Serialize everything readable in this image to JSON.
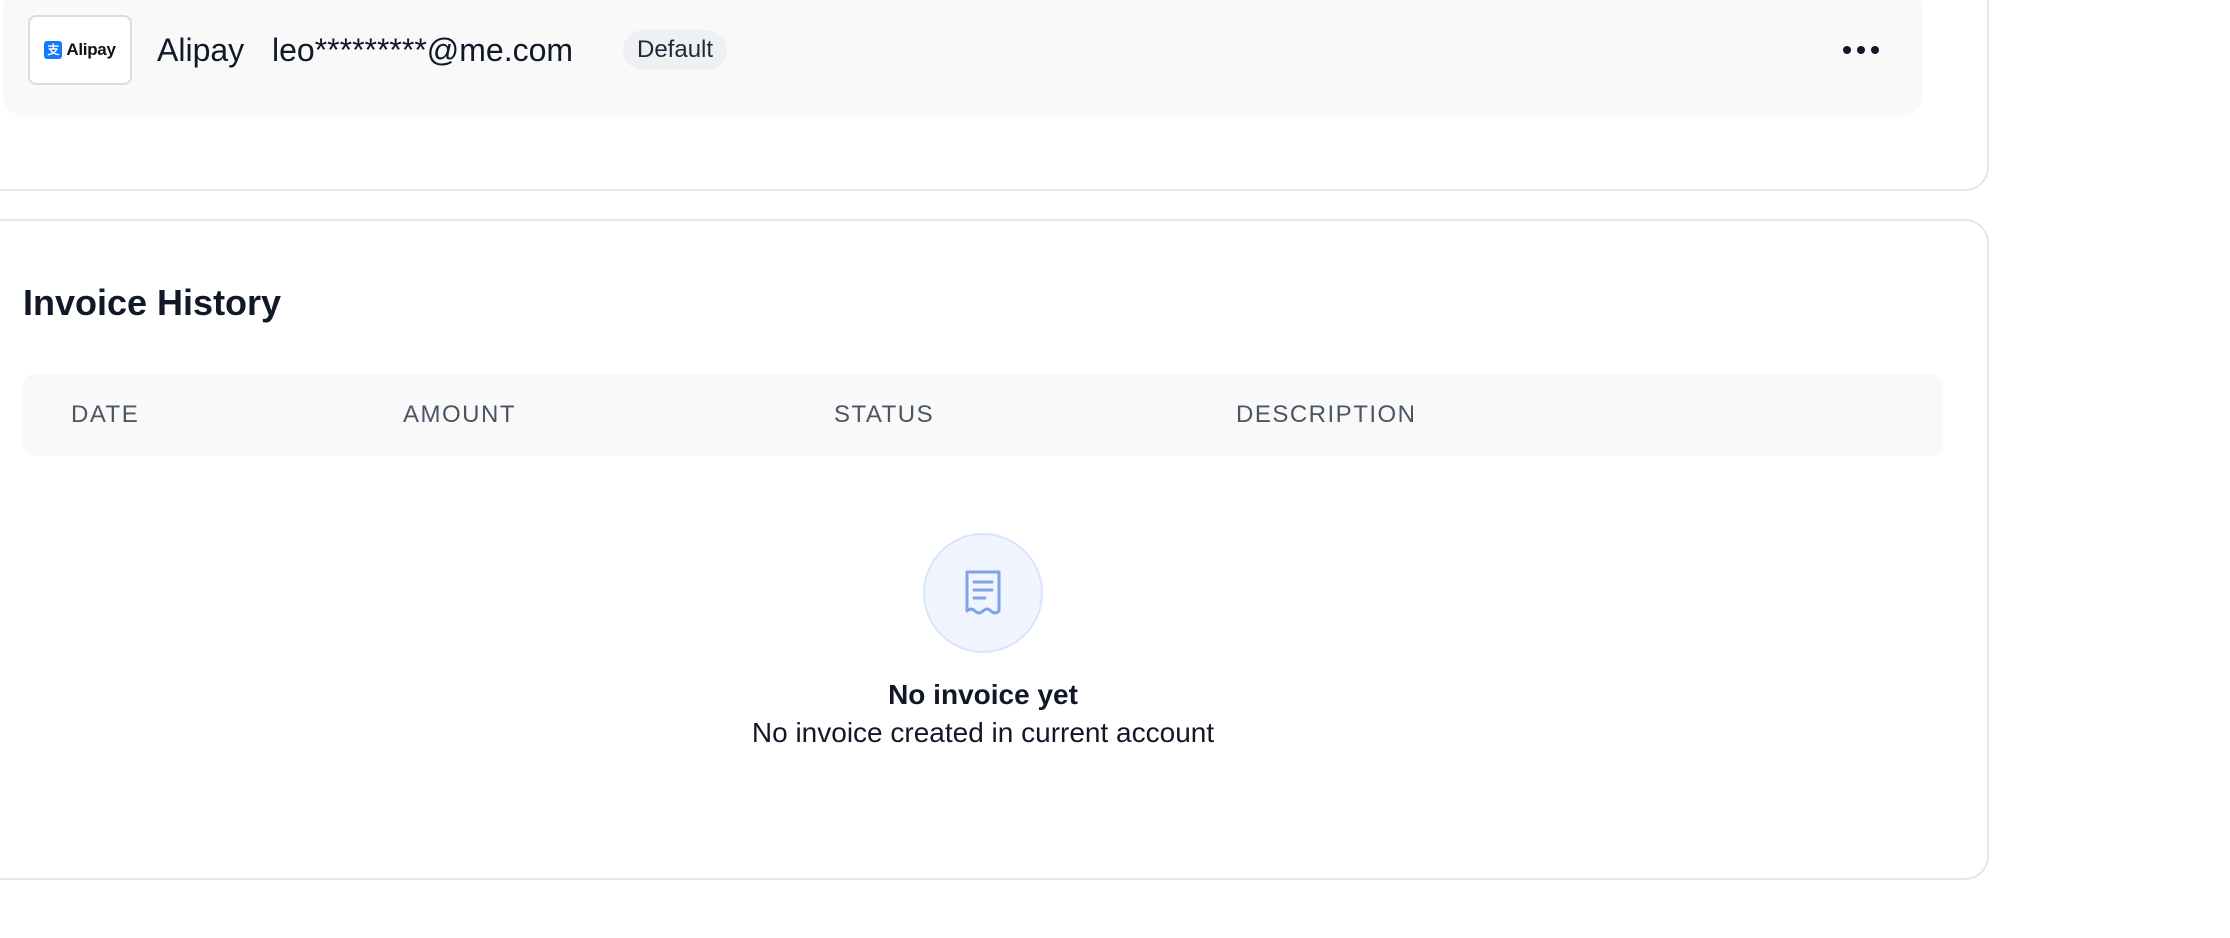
{
  "payment_method": {
    "logo_text": "Alipay",
    "logo_mark": "支",
    "name": "Alipay",
    "email": "leo*********@me.com",
    "badge": "Default",
    "more_icon": "more-horizontal-icon"
  },
  "invoice_history": {
    "title": "Invoice History",
    "columns": [
      "DATE",
      "AMOUNT",
      "STATUS",
      "DESCRIPTION"
    ],
    "empty_state": {
      "icon": "receipt-icon",
      "title": "No invoice yet",
      "subtitle": "No invoice created in current account"
    }
  },
  "colors": {
    "accent": "#1677ff",
    "icon_stroke": "#7fa3e6",
    "row_bg": "#f9f9f9"
  }
}
